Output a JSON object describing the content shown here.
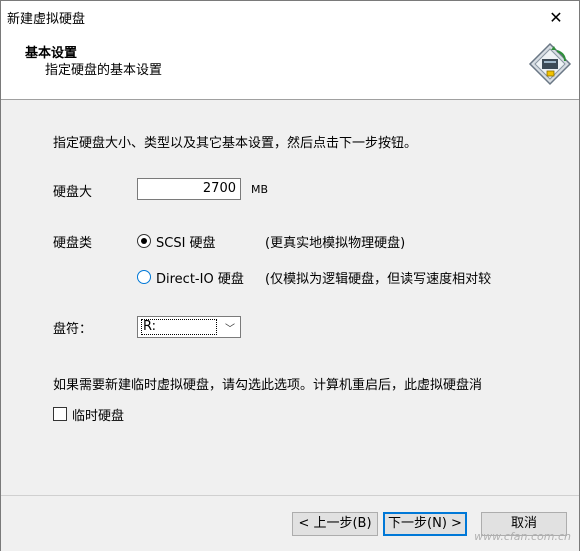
{
  "window": {
    "title": "新建虚拟硬盘",
    "close_glyph": "✕"
  },
  "header": {
    "title": "基本设置",
    "subtitle": "指定硬盘的基本设置",
    "icon": "hard-disk-wizard-icon"
  },
  "content": {
    "description": "指定硬盘大小、类型以及其它基本设置，然后点击下一步按钮。",
    "size": {
      "label": "硬盘大",
      "value": "2700",
      "unit": "MB"
    },
    "type": {
      "label": "硬盘类",
      "options": [
        {
          "label": "SCSI 硬盘",
          "hint": "(更真实地模拟物理硬盘)",
          "selected": true
        },
        {
          "label": "Direct-IO 硬盘",
          "hint": "(仅模拟为逻辑硬盘，但读写速度相对较",
          "selected": false
        }
      ]
    },
    "drive": {
      "label": "盘符：",
      "value": "R:",
      "arrow": "﹀"
    },
    "note": "如果需要新建临时虚拟硬盘，请勾选此选项。计算机重启后，此虚拟硬盘消",
    "temp_checkbox": {
      "label": "临时硬盘",
      "checked": false
    }
  },
  "footer": {
    "back_label": "< 上一步(B)",
    "next_label": "下一步(N) >",
    "cancel_label": "取消",
    "watermark": "www.cfan.com.cn"
  }
}
